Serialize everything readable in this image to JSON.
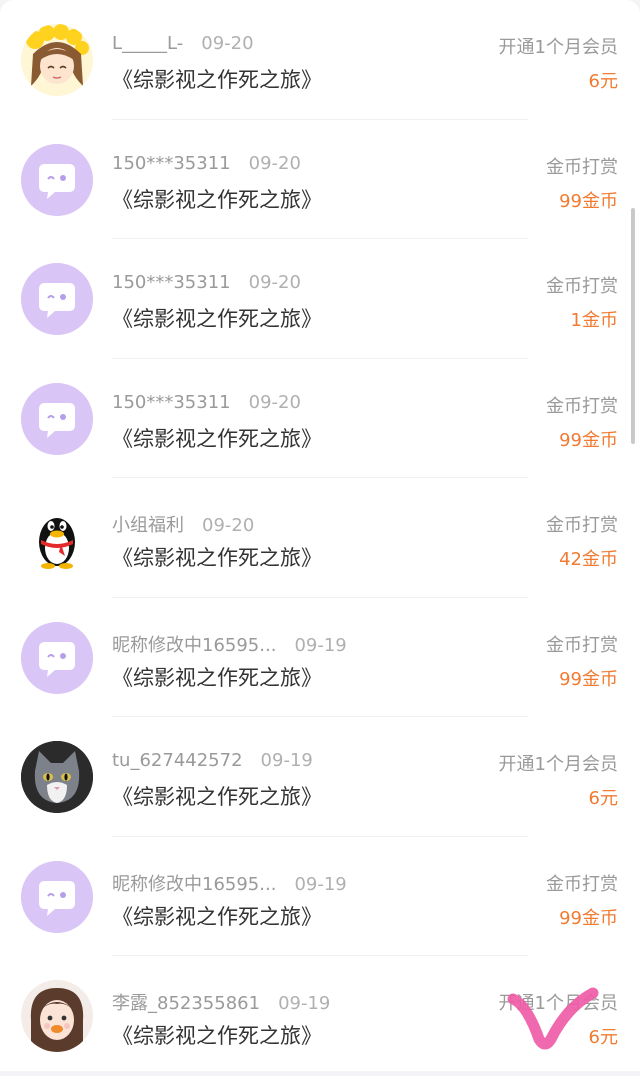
{
  "colors": {
    "accent": "#f07b31",
    "default_avatar": "#d9c6f7",
    "check_mark": "#ef5ca8"
  },
  "records": [
    {
      "user": "L_____L-",
      "date": "09-20",
      "book": "《综影视之作死之旅》",
      "type": "开通1个月会员",
      "amount": "6元",
      "avatar": "cartoon-girl-avatar"
    },
    {
      "user": "150***35311",
      "date": "09-20",
      "book": "《综影视之作死之旅》",
      "type": "金币打赏",
      "amount": "99金币",
      "avatar": "default-chat-avatar"
    },
    {
      "user": "150***35311",
      "date": "09-20",
      "book": "《综影视之作死之旅》",
      "type": "金币打赏",
      "amount": "1金币",
      "avatar": "default-chat-avatar"
    },
    {
      "user": "150***35311",
      "date": "09-20",
      "book": "《综影视之作死之旅》",
      "type": "金币打赏",
      "amount": "99金币",
      "avatar": "default-chat-avatar"
    },
    {
      "user": "小组福利",
      "date": "09-20",
      "book": "《综影视之作死之旅》",
      "type": "金币打赏",
      "amount": "42金币",
      "avatar": "penguin-avatar"
    },
    {
      "user": "昵称修改中16595...",
      "date": "09-19",
      "book": "《综影视之作死之旅》",
      "type": "金币打赏",
      "amount": "99金币",
      "avatar": "default-chat-avatar"
    },
    {
      "user": "tu_627442572",
      "date": "09-19",
      "book": "《综影视之作死之旅》",
      "type": "开通1个月会员",
      "amount": "6元",
      "avatar": "cat-photo-avatar"
    },
    {
      "user": "昵称修改中16595...",
      "date": "09-19",
      "book": "《综影视之作死之旅》",
      "type": "金币打赏",
      "amount": "99金币",
      "avatar": "default-chat-avatar"
    },
    {
      "user": "李露_852355861",
      "date": "09-19",
      "book": "《综影视之作死之旅》",
      "type": "开通1个月会员",
      "amount": "6元",
      "avatar": "person-photo-avatar"
    }
  ]
}
